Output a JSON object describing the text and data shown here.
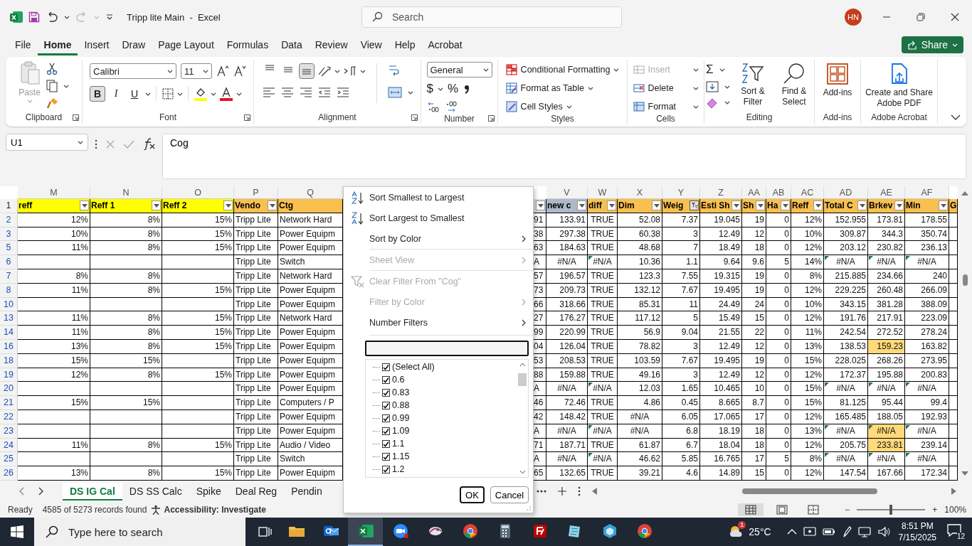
{
  "titlebar": {
    "doc_title": "Tripp lite Main  -  Excel",
    "redo_disabled": true,
    "search": {
      "placeholder": "Search"
    },
    "avatar": "HN"
  },
  "menu_tabs": [
    {
      "label": "File",
      "selected": false
    },
    {
      "label": "Home",
      "selected": true
    },
    {
      "label": "Insert",
      "selected": false
    },
    {
      "label": "Draw",
      "selected": false
    },
    {
      "label": "Page Layout",
      "selected": false
    },
    {
      "label": "Formulas",
      "selected": false
    },
    {
      "label": "Data",
      "selected": false
    },
    {
      "label": "Review",
      "selected": false
    },
    {
      "label": "View",
      "selected": false
    },
    {
      "label": "Help",
      "selected": false
    },
    {
      "label": "Acrobat",
      "selected": false
    }
  ],
  "share": "Share",
  "ribbon": [
    {
      "kind": "clipboard",
      "label": "Clipboard",
      "launcher": true,
      "paste": "Paste",
      "paste_disabled": true
    },
    {
      "kind": "font",
      "label": "Font",
      "launcher": true,
      "font_name": "Calibri",
      "font_size": "11",
      "styles": [
        {
          "text": "B",
          "kind": "bold",
          "selected": true
        },
        {
          "text": "I",
          "kind": "italic",
          "selected": false
        },
        {
          "text": "U",
          "kind": "underline",
          "selected": false
        }
      ]
    },
    {
      "kind": "alignment",
      "label": "Alignment",
      "launcher": true,
      "vertical": [
        {
          "kind": "top",
          "selected": false
        },
        {
          "kind": "middle",
          "selected": false
        },
        {
          "kind": "bottom",
          "selected": true
        }
      ]
    },
    {
      "kind": "number",
      "label": "Number",
      "launcher": true,
      "format": "General",
      "currency": "$",
      "percent": "%"
    },
    {
      "kind": "styles",
      "label": "Styles",
      "launcher": false,
      "items": [
        {
          "label": "Conditional Formatting",
          "kind": "conditional"
        },
        {
          "label": "Format as Table",
          "kind": "table"
        },
        {
          "label": "Cell Styles",
          "kind": "cellstyles"
        }
      ]
    },
    {
      "kind": "cells",
      "label": "Cells",
      "launcher": false,
      "items": [
        {
          "label": "Insert",
          "kind": "insert",
          "disabled": true
        },
        {
          "label": "Delete",
          "kind": "delete",
          "disabled": false
        },
        {
          "label": "Format",
          "kind": "format",
          "disabled": false
        }
      ]
    },
    {
      "kind": "editing",
      "label": "Editing",
      "launcher": false,
      "sum": "Σ",
      "sort": "Sort & Filter",
      "find": "Find & Select"
    },
    {
      "kind": "addins",
      "label": "Add-ins",
      "launcher": false,
      "button": "Add-ins"
    },
    {
      "kind": "acrobat",
      "label": "Adobe Acrobat",
      "launcher": false,
      "button": "Create and Share Adobe PDF"
    }
  ],
  "formula_bar": {
    "name_box": "U1",
    "value": "Cog"
  },
  "sheet": {
    "header_row": "1",
    "columns": [
      {
        "letter": "M",
        "header": "reff",
        "color": "#ffff00",
        "kind": "number",
        "filter": true,
        "filtered": false
      },
      {
        "letter": "N",
        "header": "Reff 1",
        "color": "#ffff00",
        "kind": "number",
        "filter": true,
        "filtered": false
      },
      {
        "letter": "O",
        "header": "Reff 2",
        "color": "#ffff00",
        "kind": "number",
        "filter": true,
        "filtered": false
      },
      {
        "letter": "P",
        "header": "Vendo",
        "color": "#f9c04f",
        "kind": "text",
        "filter": true,
        "filtered": false
      },
      {
        "letter": "Q",
        "header": "Ctg",
        "color": "#f9c04f",
        "kind": "text",
        "filter": false
      },
      {
        "color": "#d6dce4",
        "kind": "text",
        "filter": true,
        "filtered": false
      },
      {
        "letter": "V",
        "header": "new c",
        "color": "#adb9ca",
        "kind": "number",
        "filter": true,
        "filtered": false
      },
      {
        "letter": "W",
        "header": "diff",
        "color": "#f9c04f",
        "kind": "boolean",
        "filter": true,
        "filtered": false
      },
      {
        "letter": "X",
        "header": "Dim",
        "color": "#f9c04f",
        "kind": "number",
        "filter": true,
        "filtered": false
      },
      {
        "letter": "Y",
        "header": "Weig",
        "color": "#f9c04f",
        "kind": "number",
        "filter": true,
        "filtered": true
      },
      {
        "letter": "Z",
        "header": "Esti Sh",
        "color": "#f9c04f",
        "kind": "number",
        "filter": true,
        "filtered": false
      },
      {
        "letter": "AA",
        "header": "Sh",
        "color": "#f9c04f",
        "kind": "number",
        "filter": true,
        "filtered": false
      },
      {
        "letter": "AB",
        "header": "Ha",
        "color": "#f9c04f",
        "kind": "number",
        "filter": true,
        "filtered": false
      },
      {
        "letter": "AC",
        "header": "Reff",
        "color": "#f9c04f",
        "kind": "number",
        "filter": true,
        "filtered": false
      },
      {
        "letter": "AD",
        "header": "Total C",
        "color": "#f9c04f",
        "kind": "number",
        "filter": true,
        "filtered": false
      },
      {
        "letter": "AE",
        "header": "Brkev",
        "color": "#f9c04f",
        "kind": "number",
        "filter": true,
        "filtered": false
      },
      {
        "letter": "AF",
        "header": "Min",
        "color": "#f9c04f",
        "kind": "number",
        "filter": true,
        "filtered": false
      },
      {
        "header": "G",
        "color": "#f9c04f",
        "filter": false
      }
    ],
    "rows": [
      {
        "number": "2",
        "cells": [
          "12%",
          "8%",
          "15%",
          "Tripp Lite",
          "Network Hard",
          "91",
          "133.91",
          "TRUE",
          "52.08",
          "7.37",
          "19.045",
          "19",
          "0",
          "12%",
          "152.955",
          "173.81",
          "178.55"
        ]
      },
      {
        "number": "3",
        "cells": [
          "10%",
          "8%",
          "15%",
          "Tripp Lite",
          "Power Equipm",
          "38",
          "297.38",
          "TRUE",
          "60.38",
          "3",
          "12.49",
          "12",
          "0",
          "10%",
          "309.87",
          "344.3",
          "350.74"
        ]
      },
      {
        "number": "5",
        "cells": [
          "11%",
          "8%",
          "15%",
          "Tripp Lite",
          "Power Equipm",
          "63",
          "184.63",
          "TRUE",
          "48.68",
          "7",
          "18.49",
          "18",
          "0",
          "12%",
          "203.12",
          "230.82",
          "236.13"
        ]
      },
      {
        "number": "6",
        "cells": [
          null,
          null,
          null,
          "Tripp Lite",
          "Switch",
          "A",
          {
            "text": "#N/A",
            "kind": "error",
            "flagged": false,
            "highlighted": false
          },
          {
            "text": "#N/A",
            "kind": "error",
            "flagged": true,
            "highlighted": false
          },
          "10.36",
          "1.1",
          "9.64",
          "9.6",
          "5",
          "14%",
          {
            "text": "#N/A",
            "kind": "error",
            "flagged": true,
            "highlighted": false
          },
          {
            "text": "#N/A",
            "kind": "error",
            "flagged": true,
            "highlighted": false
          },
          {
            "text": "#N/A",
            "kind": "error",
            "flagged": true,
            "highlighted": false
          }
        ]
      },
      {
        "number": "7",
        "cells": [
          "8%",
          "8%",
          null,
          "Tripp Lite",
          "Network Hard",
          "57",
          "196.57",
          "TRUE",
          "123.3",
          "7.55",
          "19.315",
          "19",
          "0",
          "8%",
          "215.885",
          "234.66",
          "240"
        ]
      },
      {
        "number": "8",
        "cells": [
          "11%",
          "8%",
          "15%",
          "Tripp Lite",
          "Power Equipm",
          "73",
          "209.73",
          "TRUE",
          "132.12",
          "7.67",
          "19.495",
          "19",
          "0",
          "12%",
          "229.225",
          "260.48",
          "266.09"
        ]
      },
      {
        "number": "10",
        "cells": [
          null,
          null,
          null,
          "Tripp Lite",
          "Power Equipm",
          "66",
          "318.66",
          "TRUE",
          "85.31",
          "11",
          "24.49",
          "24",
          "0",
          "10%",
          "343.15",
          "381.28",
          "388.09"
        ]
      },
      {
        "number": "13",
        "cells": [
          "11%",
          "8%",
          "15%",
          "Tripp Lite",
          "Network Hard",
          "27",
          "176.27",
          "TRUE",
          "117.12",
          "5",
          "15.49",
          "15",
          "0",
          "12%",
          "191.76",
          "217.91",
          "223.09"
        ]
      },
      {
        "number": "14",
        "cells": [
          "11%",
          "8%",
          "15%",
          "Tripp Lite",
          "Power Equipm",
          "99",
          "220.99",
          "TRUE",
          "56.9",
          "9.04",
          "21.55",
          "22",
          "0",
          "11%",
          "242.54",
          "272.52",
          "278.24"
        ]
      },
      {
        "number": "16",
        "cells": [
          "13%",
          "8%",
          "15%",
          "Tripp Lite",
          "Power Equipm",
          "04",
          "126.04",
          "TRUE",
          "78.82",
          "3",
          "12.49",
          "12",
          "0",
          "13%",
          "138.53",
          {
            "text": "159.23",
            "kind": "value",
            "flagged": false,
            "highlighted": true
          },
          "163.82"
        ]
      },
      {
        "number": "18",
        "cells": [
          "15%",
          "15%",
          null,
          "Tripp Lite",
          "Power Equipm",
          "53",
          "208.53",
          "TRUE",
          "103.59",
          "7.67",
          "19.495",
          "19",
          "0",
          "15%",
          "228.025",
          "268.26",
          "273.95"
        ]
      },
      {
        "number": "19",
        "cells": [
          "12%",
          "8%",
          "15%",
          "Tripp Lite",
          "Power Equipm",
          "88",
          "159.88",
          "TRUE",
          "49.16",
          "3",
          "12.49",
          "12",
          "0",
          "12%",
          "172.37",
          "195.88",
          "200.83"
        ]
      },
      {
        "number": "20",
        "cells": [
          null,
          null,
          null,
          "Tripp Lite",
          "Power Equipm",
          "A",
          {
            "text": "#N/A",
            "kind": "error",
            "flagged": false,
            "highlighted": false
          },
          {
            "text": "#N/A",
            "kind": "error",
            "flagged": true,
            "highlighted": false
          },
          "12.03",
          "1.65",
          "10.465",
          "10",
          "0",
          "15%",
          {
            "text": "#N/A",
            "kind": "error",
            "flagged": true,
            "highlighted": false
          },
          {
            "text": "#N/A",
            "kind": "error",
            "flagged": true,
            "highlighted": false
          },
          {
            "text": "#N/A",
            "kind": "error",
            "flagged": true,
            "highlighted": false
          }
        ]
      },
      {
        "number": "21",
        "cells": [
          "15%",
          "15%",
          null,
          "Tripp Lite",
          "Computers / P",
          "46",
          "72.46",
          "TRUE",
          "4.86",
          "0.45",
          "8.665",
          "8.7",
          "0",
          "15%",
          "81.125",
          "95.44",
          "99.4"
        ]
      },
      {
        "number": "22",
        "cells": [
          null,
          null,
          null,
          "Tripp Lite",
          "Power Equipm",
          "42",
          "148.42",
          "TRUE",
          {
            "text": "#N/A",
            "kind": "error",
            "flagged": false,
            "highlighted": false
          },
          "6.05",
          "17.065",
          "17",
          "0",
          "12%",
          "165.485",
          "188.05",
          "192.93"
        ]
      },
      {
        "number": "23",
        "cells": [
          null,
          null,
          null,
          "Tripp Lite",
          "Power Equipm",
          "A",
          {
            "text": "#N/A",
            "kind": "error",
            "flagged": false,
            "highlighted": false
          },
          {
            "text": "#N/A",
            "kind": "error",
            "flagged": true,
            "highlighted": false
          },
          {
            "text": "#N/A",
            "kind": "error",
            "flagged": false,
            "highlighted": false
          },
          "6.8",
          "18.19",
          "18",
          "0",
          "13%",
          {
            "text": "#N/A",
            "kind": "error",
            "flagged": true,
            "highlighted": false
          },
          {
            "text": "#N/A",
            "kind": "error",
            "flagged": true,
            "highlighted": true
          },
          {
            "text": "#N/A",
            "kind": "error",
            "flagged": true,
            "highlighted": false
          }
        ]
      },
      {
        "number": "24",
        "cells": [
          "11%",
          "8%",
          "15%",
          "Tripp Lite",
          "Audio / Video",
          "71",
          "187.71",
          "TRUE",
          "61.87",
          "6.7",
          "18.04",
          "18",
          "0",
          "12%",
          "205.75",
          {
            "text": "233.81",
            "kind": "value",
            "flagged": false,
            "highlighted": true
          },
          "239.14"
        ]
      },
      {
        "number": "25",
        "cells": [
          null,
          null,
          null,
          "Tripp Lite",
          "Switch",
          "A",
          {
            "text": "#N/A",
            "kind": "error",
            "flagged": false,
            "highlighted": false
          },
          {
            "text": "#N/A",
            "kind": "error",
            "flagged": true,
            "highlighted": false
          },
          "46.62",
          "5.85",
          "16.765",
          "17",
          "5",
          "8%",
          {
            "text": "#N/A",
            "kind": "error",
            "flagged": true,
            "highlighted": false
          },
          {
            "text": "#N/A",
            "kind": "error",
            "flagged": true,
            "highlighted": false
          },
          {
            "text": "#N/A",
            "kind": "error",
            "flagged": true,
            "highlighted": false
          }
        ]
      },
      {
        "number": "26",
        "cells": [
          "13%",
          "8%",
          "15%",
          "Tripp Lite",
          "Power Equipm",
          "65",
          "132.65",
          "TRUE",
          "39.21",
          "4.6",
          "14.89",
          "15",
          "0",
          "12%",
          "147.54",
          "167.66",
          "172.34"
        ]
      }
    ]
  },
  "filter_menu": {
    "items": [
      {
        "label": "Sort Smallest to Largest",
        "kind": "sort-asc",
        "disabled": false,
        "submenu": false,
        "divider_before": false
      },
      {
        "label": "Sort Largest to Smallest",
        "kind": "sort-desc",
        "disabled": false,
        "submenu": false,
        "divider_before": false
      },
      {
        "label": "Sort by Color",
        "kind": "plain",
        "disabled": false,
        "submenu": true,
        "divider_before": false
      },
      {
        "label": "Sheet View",
        "kind": "plain",
        "disabled": true,
        "submenu": true,
        "divider_before": true
      },
      {
        "label": "Clear Filter From \"Cog\"",
        "kind": "clear-filter",
        "disabled": true,
        "submenu": false,
        "divider_before": true
      },
      {
        "label": "Filter by Color",
        "kind": "plain",
        "disabled": true,
        "submenu": true,
        "divider_before": false
      },
      {
        "label": "Number Filters",
        "kind": "plain",
        "disabled": false,
        "submenu": true,
        "divider_before": false
      }
    ],
    "values": [
      {
        "label": "(Select All)",
        "checked": true
      },
      {
        "label": "0.6",
        "checked": true
      },
      {
        "label": "0.83",
        "checked": true
      },
      {
        "label": "0.88",
        "checked": true
      },
      {
        "label": "0.99",
        "checked": true
      },
      {
        "label": "1.09",
        "checked": true
      },
      {
        "label": "1.1",
        "checked": true
      },
      {
        "label": "1.15",
        "checked": true
      },
      {
        "label": "1.2",
        "checked": true
      }
    ],
    "ok": "OK",
    "cancel": "Cancel"
  },
  "sheet_tabs": [
    {
      "label": "DS IG Cal",
      "selected": true
    },
    {
      "label": "DS SS Calc",
      "selected": false
    },
    {
      "label": "Spike",
      "selected": false
    },
    {
      "label": "Deal Reg",
      "selected": false
    },
    {
      "label": "Pendin",
      "selected": false
    }
  ],
  "status_bar": {
    "mode": "Ready",
    "records": "4585 of 5273 records found",
    "accessibility": "Accessibility: Investigate",
    "views": [
      {
        "kind": "normal",
        "selected": true
      },
      {
        "kind": "page-layout",
        "selected": false
      },
      {
        "kind": "page-break",
        "selected": false
      }
    ],
    "zoom": {
      "level": 0.5,
      "minus": "−",
      "plus": "+",
      "reading": "100%"
    }
  },
  "taskbar": {
    "search": {
      "placeholder": "Type here to search"
    },
    "apps": [
      {
        "kind": "folder",
        "selected": false
      },
      {
        "kind": "mail",
        "selected": false
      },
      {
        "kind": "spreadsheet",
        "selected": true
      },
      {
        "kind": "video",
        "selected": false
      },
      {
        "kind": "bird",
        "selected": false
      },
      {
        "kind": "browser",
        "selected": false
      },
      {
        "kind": "calculator",
        "selected": false
      },
      {
        "kind": "ftp",
        "selected": false
      },
      {
        "kind": "notes",
        "selected": false
      },
      {
        "kind": "cube",
        "selected": false
      },
      {
        "kind": "browser",
        "selected": false
      }
    ],
    "weather_badge": "1",
    "temperature": "25°C",
    "time": "8:51 PM",
    "date": "7/15/2025",
    "notifications": "12"
  }
}
